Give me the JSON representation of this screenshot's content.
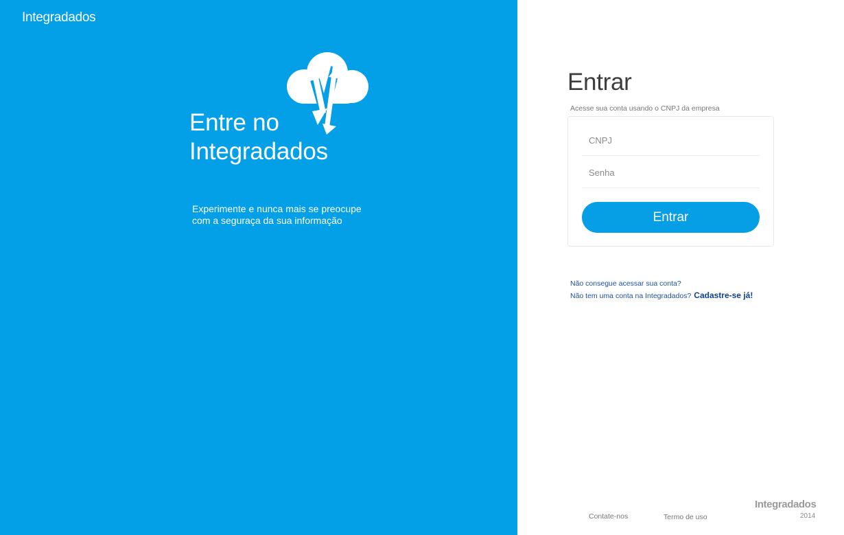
{
  "left_panel": {
    "brand": "Integradados",
    "hero_title_line1": "Entre no",
    "hero_title_line2": "Integradados",
    "hero_subtitle_line1": "Experimente e nunca mais se preocupe",
    "hero_subtitle_line2": "com a seguraça da sua informação",
    "background_color": "#039fe7",
    "icon": "cloud-sync-icon"
  },
  "login": {
    "title": "Entrar",
    "subtitle": "Acesse sua conta usando o CNPJ da empresa",
    "cnpj_placeholder": "CNPJ",
    "password_placeholder": "Senha",
    "submit_label": "Entrar",
    "button_color": "#069fe6"
  },
  "help": {
    "forgot_account": "Não consegue acessar sua conta?",
    "no_account": "Não tem uma conta na Integradados?",
    "signup": "Cadastre-se já!"
  },
  "footer": {
    "contact": "Contate-nos",
    "terms": "Termo de uso",
    "brand": "Integradados",
    "year": "2014"
  }
}
